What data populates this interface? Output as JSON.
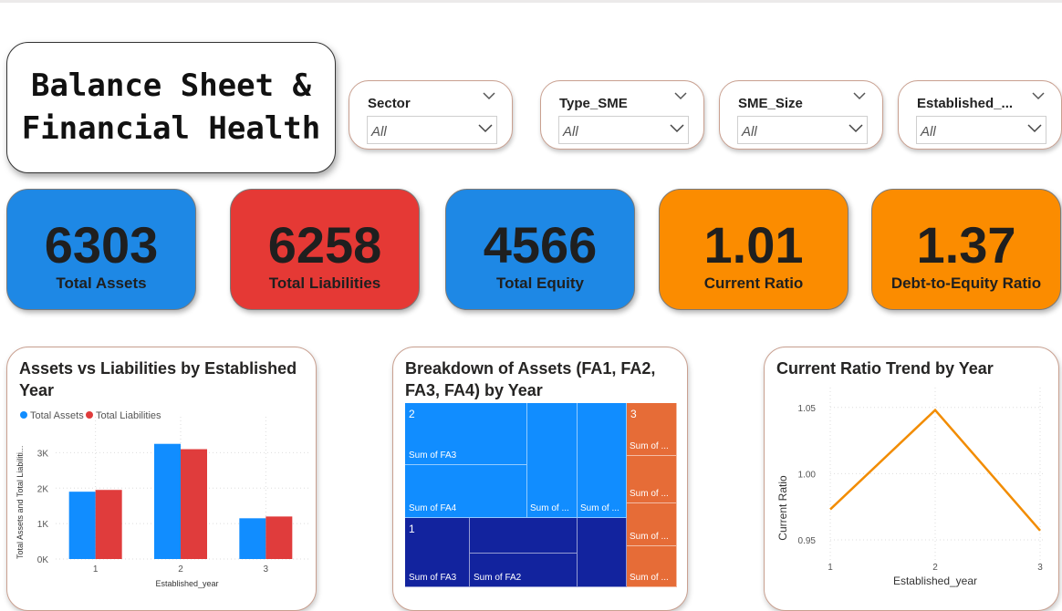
{
  "title": {
    "line1": "Balance Sheet &",
    "line2": "Financial Health"
  },
  "slicers": [
    {
      "label": "Sector",
      "value": "All"
    },
    {
      "label": "Type_SME",
      "value": "All"
    },
    {
      "label": "SME_Size",
      "value": "All"
    },
    {
      "label": "Established_...",
      "value": "All"
    }
  ],
  "kpis": [
    {
      "value": "6303",
      "label": "Total Assets",
      "color": "#1e88e5"
    },
    {
      "value": "6258",
      "label": "Total Liabilities",
      "color": "#e53935"
    },
    {
      "value": "4566",
      "label": "Total Equity",
      "color": "#1e88e5"
    },
    {
      "value": "1.01",
      "label": "Current Ratio",
      "color": "#fb8c00"
    },
    {
      "value": "1.37",
      "label": "Debt-to-Equity Ratio",
      "color": "#fb8c00"
    }
  ],
  "bar_chart": {
    "title_line1": "Assets vs Liabilities by Established",
    "title_line2": "Year",
    "legend": [
      "Total Assets",
      "Total Liabilities"
    ],
    "colors": [
      "#118dff",
      "#e03c3c"
    ],
    "ylabel": "Total Assets and Total Liabiliti...",
    "xlabel": "Established_year",
    "yticks": [
      "0K",
      "1K",
      "2K",
      "3K"
    ]
  },
  "treemap": {
    "title_line1": "Breakdown of Assets (FA1, FA2,",
    "title_line2": "FA3, FA4) by Year",
    "colors": {
      "year2": "#118dff",
      "year1": "#12239e",
      "year3": "#e66c37"
    },
    "groups": [
      {
        "label": "2",
        "tiles": [
          "Sum of FA3",
          "Sum of FA4",
          "Sum of ...",
          "Sum of ..."
        ]
      },
      {
        "label": "1",
        "tiles": [
          "Sum of FA3",
          "Sum of FA2",
          "",
          ""
        ]
      },
      {
        "label": "3",
        "tiles": [
          "Sum of ...",
          "Sum of ...",
          "Sum of ...",
          "Sum of ..."
        ]
      }
    ]
  },
  "line_chart": {
    "title": "Current Ratio Trend by Year",
    "ylabel": "Current Ratio",
    "xlabel": "Established_year",
    "color": "#f28c00",
    "yticks": [
      "0.95",
      "1.00",
      "1.05"
    ]
  },
  "chart_data": [
    {
      "type": "bar",
      "title": "Assets vs Liabilities by Established Year",
      "xlabel": "Established_year",
      "ylabel": "Total Assets and Total Liabiliti...",
      "categories": [
        "1",
        "2",
        "3"
      ],
      "series": [
        {
          "name": "Total Assets",
          "values": [
            1900,
            3250,
            1150
          ]
        },
        {
          "name": "Total Liabilities",
          "values": [
            1950,
            3100,
            1200
          ]
        }
      ],
      "ylim": [
        0,
        3500
      ],
      "grid": true,
      "legend": "top-left"
    },
    {
      "type": "line",
      "title": "Current Ratio Trend by Year",
      "xlabel": "Established_year",
      "ylabel": "Current Ratio",
      "x": [
        "1",
        "2",
        "3"
      ],
      "series": [
        {
          "name": "Current Ratio",
          "values": [
            0.973,
            1.048,
            0.957
          ]
        }
      ],
      "ylim": [
        0.93,
        1.065
      ],
      "grid": true
    }
  ]
}
